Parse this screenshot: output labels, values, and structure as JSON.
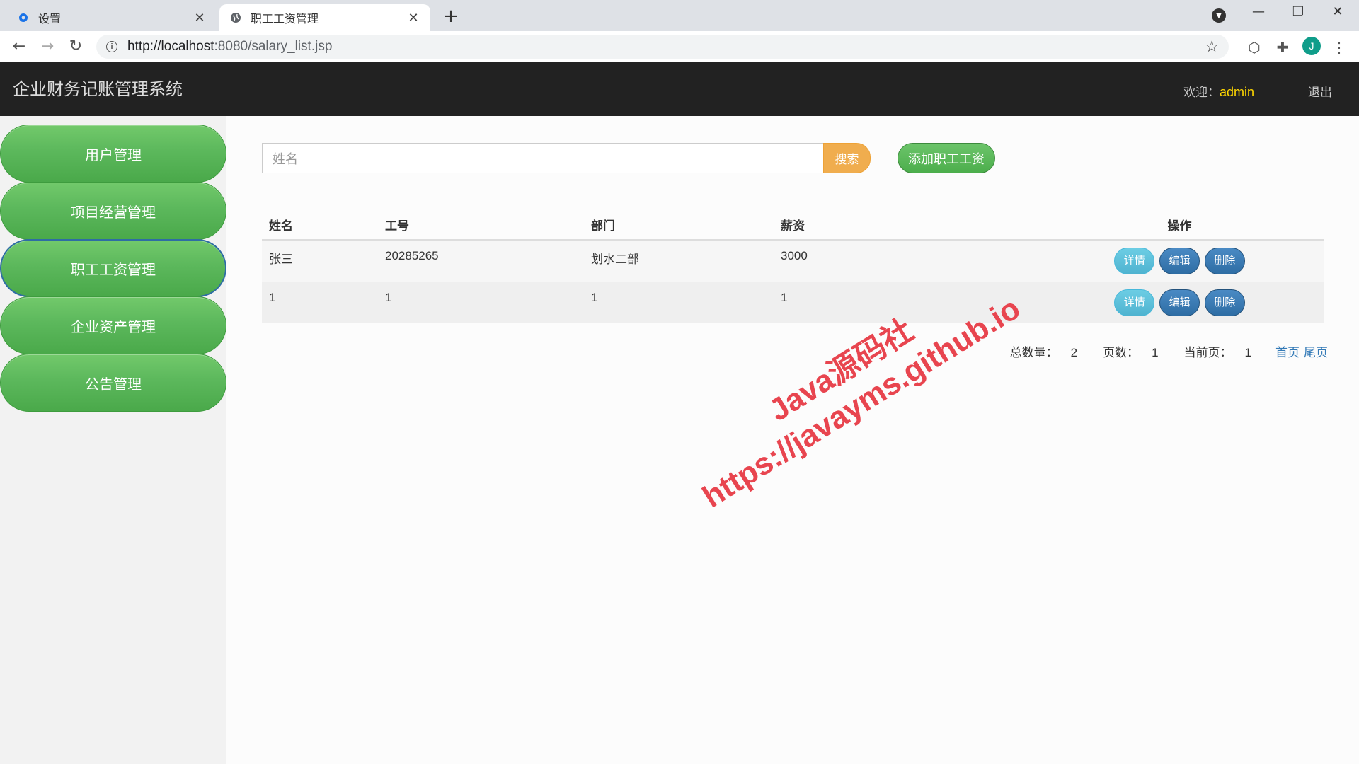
{
  "browser": {
    "tabs": [
      {
        "title": "设置",
        "icon": "gear-icon",
        "active": false
      },
      {
        "title": "职工工资管理",
        "icon": "globe-icon",
        "active": true
      }
    ],
    "url_host": "http://localhost",
    "url_rest": ":8080/salary_list.jsp",
    "profile_initial": "J"
  },
  "header": {
    "app_title": "企业财务记账管理系统",
    "welcome_label": "欢迎：",
    "username": "admin",
    "logout_label": "退出"
  },
  "sidebar": {
    "items": [
      {
        "label": "用户管理"
      },
      {
        "label": "项目经营管理"
      },
      {
        "label": "职工工资管理"
      },
      {
        "label": "企业资产管理"
      },
      {
        "label": "公告管理"
      }
    ],
    "active_index": 2
  },
  "search": {
    "placeholder": "姓名",
    "button_label": "搜索",
    "add_button_label": "添加职工工资"
  },
  "table": {
    "headers": [
      "姓名",
      "工号",
      "部门",
      "薪资",
      "操作"
    ],
    "rows": [
      {
        "name": "张三",
        "id": "20285265",
        "dept": "划水二部",
        "salary": "3000"
      },
      {
        "name": "1",
        "id": "1",
        "dept": "1",
        "salary": "1"
      }
    ],
    "actions": {
      "detail": "详情",
      "edit": "编辑",
      "delete": "删除"
    }
  },
  "pager": {
    "total_label": "总数量：",
    "total": "2",
    "pages_label": "页数：",
    "pages": "1",
    "current_label": "当前页：",
    "current": "1",
    "first_label": "首页",
    "last_label": "尾页"
  },
  "watermark": {
    "line1": "Java源码社",
    "line2": "https://javayms.github.io"
  },
  "colors": {
    "header_bg": "#222222",
    "sidebar_green": "#5cb85c",
    "search_orange": "#f0ad4e",
    "username_yellow": "#ffd700",
    "watermark_red": "#e8454f"
  }
}
